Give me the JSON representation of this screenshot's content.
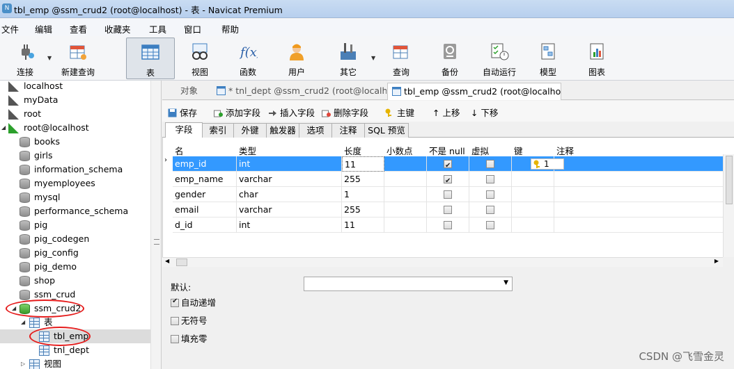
{
  "window": {
    "title": "tbl_emp @ssm_crud2 (root@localhost) - 表 - Navicat Premium"
  },
  "menu": [
    "文件",
    "编辑",
    "查看",
    "收藏夹",
    "工具",
    "窗口",
    "帮助"
  ],
  "toolbar": [
    {
      "label": "连接",
      "icon": "connection-plug-icon"
    },
    {
      "label": "新建查询",
      "icon": "new-query-icon"
    },
    {
      "label": "表",
      "icon": "table-icon",
      "active": true
    },
    {
      "label": "视图",
      "icon": "view-glasses-icon"
    },
    {
      "label": "函数",
      "icon": "function-fx-icon"
    },
    {
      "label": "用户",
      "icon": "user-icon"
    },
    {
      "label": "其它",
      "icon": "tools-icon"
    },
    {
      "label": "查询",
      "icon": "query-icon"
    },
    {
      "label": "备份",
      "icon": "backup-icon"
    },
    {
      "label": "自动运行",
      "icon": "schedule-icon"
    },
    {
      "label": "模型",
      "icon": "model-icon"
    },
    {
      "label": "图表",
      "icon": "chart-icon"
    }
  ],
  "tree": [
    {
      "label": "localhost",
      "type": "conn"
    },
    {
      "label": "myData",
      "type": "conn"
    },
    {
      "label": "root",
      "type": "conn"
    },
    {
      "label": "root@localhost",
      "type": "conn-open"
    },
    {
      "label": "books",
      "type": "db"
    },
    {
      "label": "girls",
      "type": "db"
    },
    {
      "label": "information_schema",
      "type": "db"
    },
    {
      "label": "myemployees",
      "type": "db"
    },
    {
      "label": "mysql",
      "type": "db"
    },
    {
      "label": "performance_schema",
      "type": "db"
    },
    {
      "label": "pig",
      "type": "db"
    },
    {
      "label": "pig_codegen",
      "type": "db"
    },
    {
      "label": "pig_config",
      "type": "db"
    },
    {
      "label": "pig_demo",
      "type": "db"
    },
    {
      "label": "shop",
      "type": "db"
    },
    {
      "label": "ssm_crud",
      "type": "db"
    },
    {
      "label": "ssm_crud2",
      "type": "db-open"
    },
    {
      "label": "表",
      "type": "folder"
    },
    {
      "label": "tbl_emp",
      "type": "table",
      "selected": true
    },
    {
      "label": "tnl_dept",
      "type": "table"
    },
    {
      "label": "视图",
      "type": "view-folder"
    }
  ],
  "tabs": [
    {
      "label": "对象"
    },
    {
      "label": "* tnl_dept @ssm_crud2 (root@localh..."
    },
    {
      "label": "tbl_emp @ssm_crud2 (root@localho..."
    }
  ],
  "subtoolbar": [
    "保存",
    "添加字段",
    "插入字段",
    "删除字段",
    "主键",
    "上移",
    "下移"
  ],
  "field_tabs": [
    "字段",
    "索引",
    "外键",
    "触发器",
    "选项",
    "注释",
    "SQL 预览"
  ],
  "grid": {
    "headers": [
      "名",
      "类型",
      "长度",
      "小数点",
      "不是 null",
      "虚拟",
      "键",
      "注释"
    ],
    "rows": [
      {
        "name": "emp_id",
        "type": "int",
        "length": "11",
        "notnull": true,
        "virtual": false,
        "key": "1"
      },
      {
        "name": "emp_name",
        "type": "varchar",
        "length": "255",
        "notnull": true,
        "virtual": false,
        "key": ""
      },
      {
        "name": "gender",
        "type": "char",
        "length": "1",
        "notnull": false,
        "virtual": false,
        "key": ""
      },
      {
        "name": "email",
        "type": "varchar",
        "length": "255",
        "notnull": false,
        "virtual": false,
        "key": ""
      },
      {
        "name": "d_id",
        "type": "int",
        "length": "11",
        "notnull": false,
        "virtual": false,
        "key": ""
      }
    ]
  },
  "props": {
    "default_label": "默认:",
    "auto_increment": {
      "label": "自动递增",
      "checked": true
    },
    "unsigned": {
      "label": "无符号",
      "checked": false
    },
    "zerofill": {
      "label": "填充零",
      "checked": false
    }
  },
  "watermark": "CSDN @飞雪金灵"
}
